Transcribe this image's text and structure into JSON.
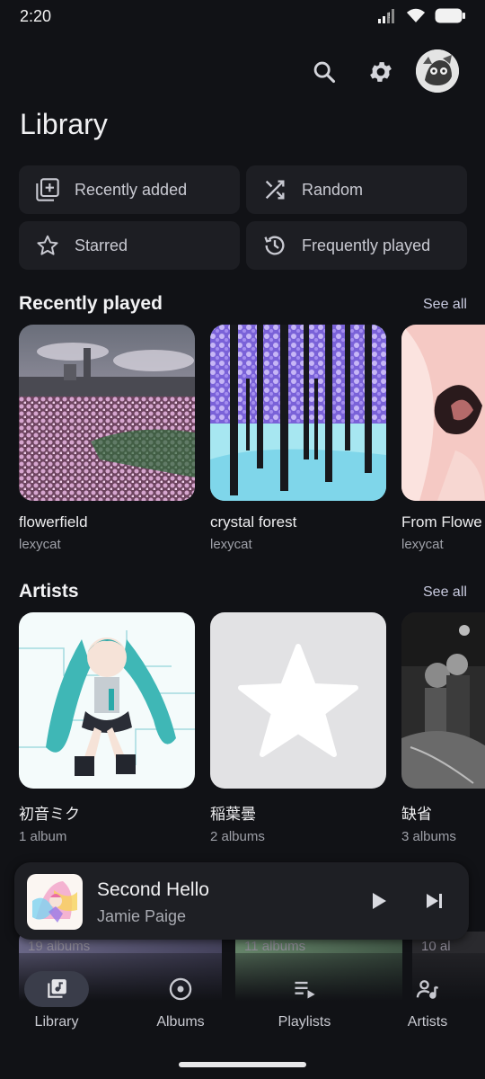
{
  "status": {
    "time": "2:20"
  },
  "header": {
    "title": "Library"
  },
  "quick_links": [
    {
      "label": "Recently added",
      "icon": "library-add-icon"
    },
    {
      "label": "Random",
      "icon": "shuffle-icon"
    },
    {
      "label": "Starred",
      "icon": "star-outline-icon"
    },
    {
      "label": "Frequently played",
      "icon": "history-icon"
    }
  ],
  "recently_played": {
    "title": "Recently played",
    "see_all": "See all",
    "items": [
      {
        "title": "flowerfield",
        "subtitle": "lexycat"
      },
      {
        "title": "crystal forest",
        "subtitle": "lexycat"
      },
      {
        "title": "From Flowe",
        "subtitle": "lexycat"
      }
    ]
  },
  "artists": {
    "title": "Artists",
    "see_all": "See all",
    "items": [
      {
        "title": "初音ミク",
        "subtitle": "1 album"
      },
      {
        "title": "稲葉曇",
        "subtitle": "2 albums"
      },
      {
        "title": "缺省",
        "subtitle": "3 albums"
      }
    ]
  },
  "peek_row": [
    "19 albums",
    "11 albums",
    "10 al"
  ],
  "now_playing": {
    "title": "Second Hello",
    "artist": "Jamie Paige"
  },
  "nav": [
    {
      "label": "Library",
      "icon": "library-music-icon"
    },
    {
      "label": "Albums",
      "icon": "album-icon"
    },
    {
      "label": "Playlists",
      "icon": "playlist-play-icon"
    },
    {
      "label": "Artists",
      "icon": "artist-icon"
    }
  ],
  "colors": {
    "background": "#111216",
    "surface": "#1d1e23",
    "nav_active": "#3a3d4a"
  }
}
